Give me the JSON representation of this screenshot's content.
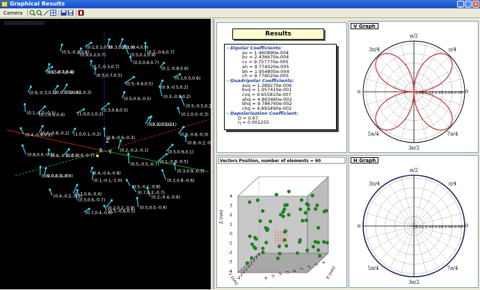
{
  "window": {
    "title": "Graphical Results"
  },
  "menu": {
    "camera": "Camera"
  },
  "toolbar": {
    "icons": [
      "zoom-in-icon",
      "zoom-out-icon",
      "measure-icon",
      "grid-icon",
      "save-icon",
      "save-as-icon",
      "exit-icon"
    ]
  },
  "vector_labels": [
    {
      "t": "(0.1,-0.4,0.9)"
    },
    {
      "t": "(0.1,0.1,0.9)"
    },
    {
      "t": "(0.3,0.2,0.9)"
    },
    {
      "t": "(0.5,0.2,0.9)"
    },
    {
      "t": "(0.5,-0.2,0.8)"
    },
    {
      "t": "(0.3,-0.6,0.7)"
    },
    {
      "t": "(0.7,-0.3,0.7)"
    },
    {
      "t": "(0.9,0.2,0.7)"
    },
    {
      "t": "(0.1,-0.8,0.6)"
    },
    {
      "t": "(0.5,0.4,0.6)"
    },
    {
      "t": "(0.5,0.6,0.7)"
    },
    {
      "t": "(0.5,-0.6,0.5)"
    },
    {
      "t": "(0.6,-0.7,0.4)"
    },
    {
      "t": "(0.1,0.5,0.6)"
    },
    {
      "t": "(0.9,-0.1,0.3)"
    },
    {
      "t": "(0.5,0.7,0.5)"
    },
    {
      "t": "(0.3,-0.9,0.2)"
    },
    {
      "t": "(0.9,-0.3,0.4)"
    },
    {
      "t": "(0.9,-0.5,0.2)"
    },
    {
      "t": "(0.3,0.8,0.5)"
    },
    {
      "t": "(0.9,0.5,0.4)"
    },
    {
      "t": "(0.5,-0.5,0.2)"
    },
    {
      "t": "(0.7,0.5,0.4)"
    },
    {
      "t": "(0.5,0.9,-0.5)"
    },
    {
      "t": "(0.7,-0.7,0.2)"
    },
    {
      "t": "(0.1,-1.0,-0.1)"
    },
    {
      "t": "(0.1,0.0,-0.3)"
    },
    {
      "t": "(1.0,0.1,-0.2)"
    },
    {
      "t": "(1.0,0.1,0.2)"
    },
    {
      "t": "(0.6,-0.6,-0.3)"
    },
    {
      "t": "(0.4,-0.9,0.2)"
    },
    {
      "t": "(0.5,0.9,0.1)"
    },
    {
      "t": "(0.2,-0.2,-0.1)"
    },
    {
      "t": "(0.4,-0.8,-0.2)"
    },
    {
      "t": "(0.8,-0.2,-0.6)"
    },
    {
      "t": "(0.8,-0.3,-0.5)"
    },
    {
      "t": "(0.8,-0.6,-0.3)"
    },
    {
      "t": "(0.1,-0.8,-0.5)"
    },
    {
      "t": "(0.8,0.0,-0.5)"
    },
    {
      "t": "(0.5,0.9,0.1)"
    },
    {
      "t": "(0.4,-0.4,-0.8)"
    },
    {
      "t": "(0.5,-0.6,-0.7)"
    },
    {
      "t": "(0.3,0.9,-0.3)"
    },
    {
      "t": "(0.9,0.2,-0.3)"
    },
    {
      "t": "(0.5,-0.5,-0.7)"
    },
    {
      "t": "(0.5,-0.1,-0.8)"
    },
    {
      "t": "(0.0,0.5,-0.9)"
    },
    {
      "t": "(0.1,0.8,-0.6)"
    },
    {
      "t": "(0.7,0.6,-0.4)"
    },
    {
      "t": "(0.1,-0.1,-1.0)"
    },
    {
      "t": "(0.2,-0.4,-0.9)"
    },
    {
      "t": "(0.4,-0.2,-0.9)"
    },
    {
      "t": "(0.7,0.2,-0.7)"
    },
    {
      "t": "(0.2,0.2,-0.9)"
    },
    {
      "t": "(0.3,0.6,-0.7)"
    },
    {
      "t": "(0.5,0.0,-0.9)"
    },
    {
      "t": "(0.7,0.4,-0.6)"
    },
    {
      "t": "(0.5,-0.6,0.5)"
    }
  ],
  "axes_3d": {
    "x": "X",
    "y": "Y",
    "z": "Z"
  },
  "results": {
    "title": "Results",
    "dipolar_title": "- Dipolar Coefficients:",
    "dipolar": [
      "av = 1.460890e-004",
      "bv = 2.436670e-004",
      "cv = 9.757770e-005",
      "ah = 9.774020e-005",
      "bh = 1.954800e-004",
      "ch = 9.774020e-005"
    ],
    "quad_title": "- Quadripolar Coefficients:",
    "quad": [
      "avq = 1.289270e-006",
      "bvq = 1.957410e-001",
      "cvq = 9.655810e-007",
      "ahq = 4.893460e-002",
      "bhq = 9.786760e-002",
      "chq = 4.893490e-002"
    ],
    "depol_title": "- Depolarisation Coefficient:",
    "depol": [
      "D = 0.67",
      "η = 0.001255"
    ]
  },
  "v_graph": {
    "title": "V Graph",
    "angle_labels": {
      "top": "π/2",
      "tl": "3π/4",
      "tr": "π/4",
      "left": "π",
      "right": "0",
      "bl": "5π/4",
      "br": "7π/4",
      "bottom": "3π/2"
    },
    "radial_ticks": "0.01 0.02 0.03 0.04 0.05",
    "curve_color": "#c03030"
  },
  "h_graph": {
    "title": "H Graph",
    "angle_labels": {
      "top": "π/2",
      "tl": "3π/4",
      "tr": "π/4",
      "left": "π",
      "right": "0",
      "bl": "5π/4",
      "br": "7π/4",
      "bottom": "3π/2"
    },
    "radial_ticks": "0.01 0.02 0.03 0.04 0.05",
    "curve_color": "#202060"
  },
  "scatter3d": {
    "title": "Vectors Position, number of elements = 60",
    "zlabel": "Z (nm)",
    "ylabel": "Y (nm)",
    "xlabel": "X (nm)",
    "z_ticks": [
      "4",
      "3",
      "2",
      "1",
      "0",
      "-1",
      "-2",
      "-3",
      "-4"
    ],
    "y_ticks": [
      "4",
      "3",
      "2",
      "1",
      "0",
      "-1",
      "-2",
      "-3",
      "-4"
    ],
    "x_ticks": [
      "-4",
      "-3",
      "-2",
      "-1",
      "0",
      "1",
      "2",
      "3",
      "4"
    ],
    "point_color": "#208020"
  }
}
